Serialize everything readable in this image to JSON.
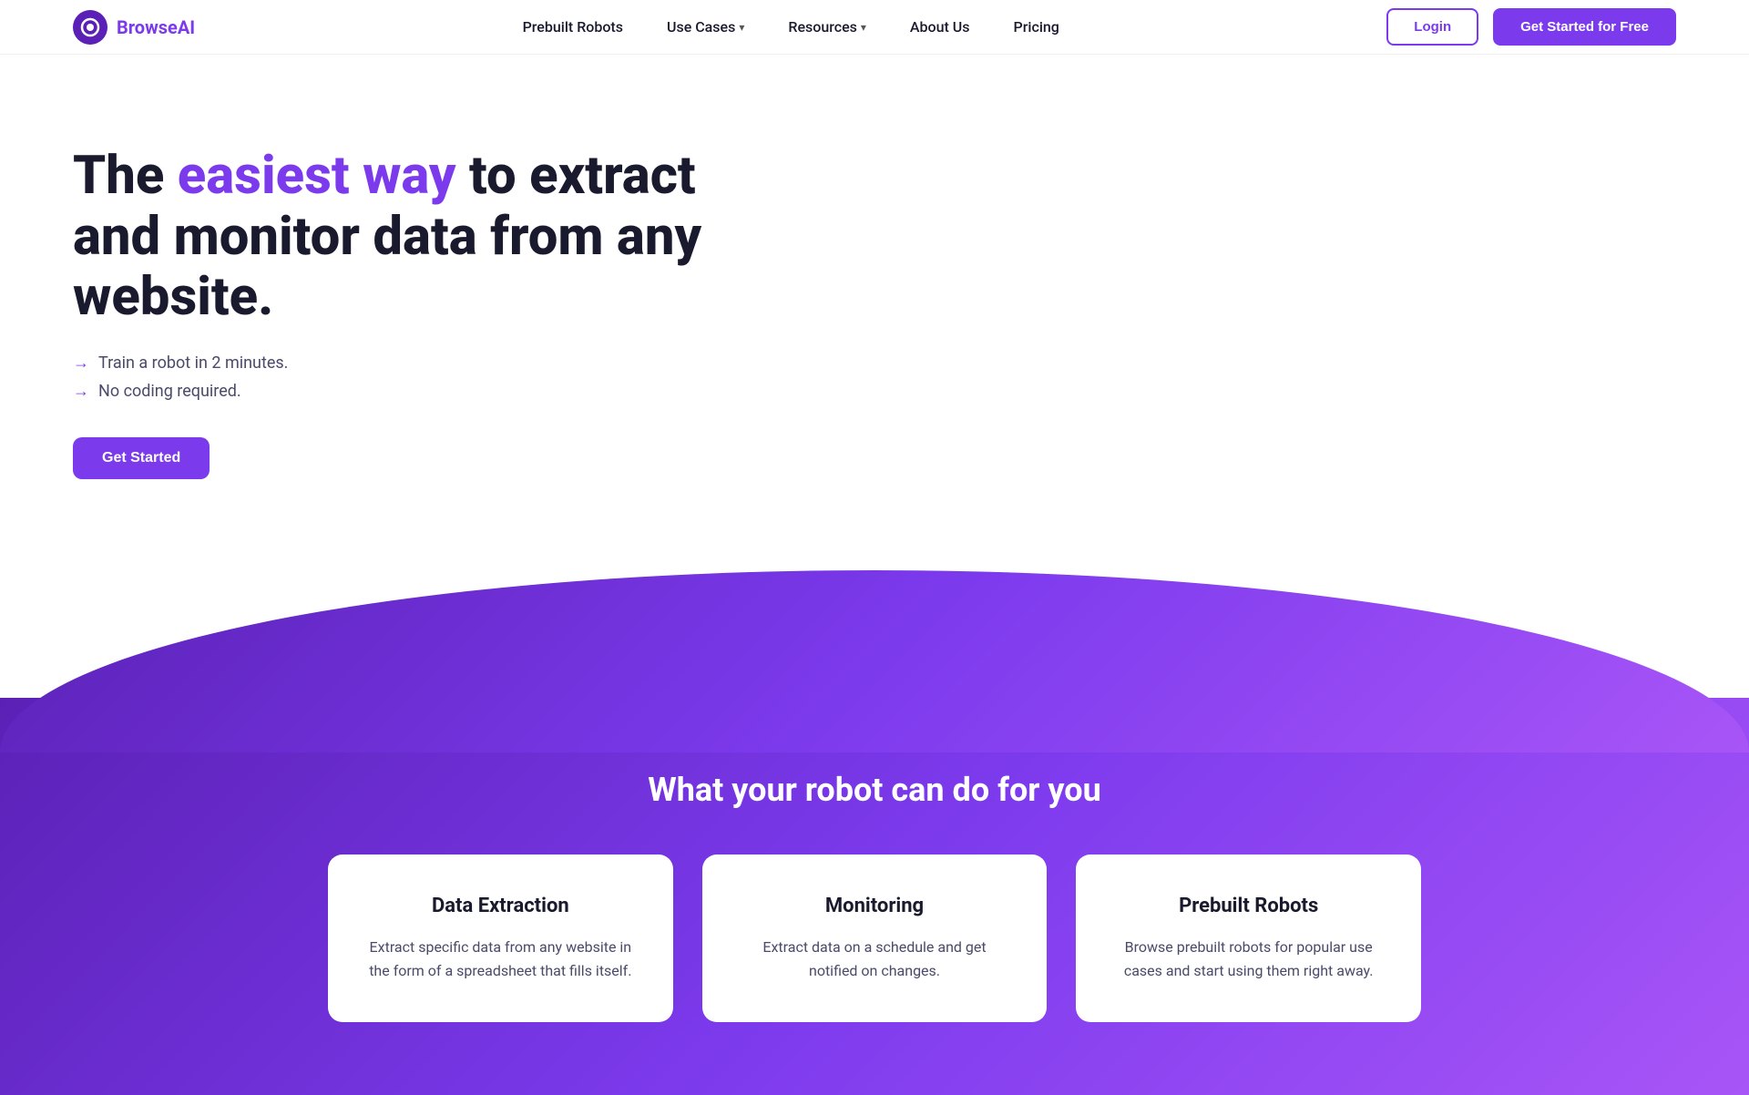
{
  "navbar": {
    "logo_text_browse": "Browse",
    "logo_text_ai": "AI",
    "nav_prebuilt": "Prebuilt Robots",
    "nav_use_cases": "Use Cases",
    "nav_resources": "Resources",
    "nav_about": "About Us",
    "nav_pricing": "Pricing",
    "btn_login": "Login",
    "btn_get_started": "Get Started for Free"
  },
  "hero": {
    "title_start": "The ",
    "title_highlight": "easiest way",
    "title_end": " to extract and monitor data from any website.",
    "bullet1": "Train a robot in 2 minutes.",
    "bullet2": "No coding required.",
    "cta_label": "Get Started"
  },
  "features_section": {
    "section_title": "What your robot can do for you",
    "cards": [
      {
        "title": "Data Extraction",
        "description": "Extract specific data from any website in the form of a spreadsheet that fills itself."
      },
      {
        "title": "Monitoring",
        "description": "Extract data on a schedule and get notified on changes."
      },
      {
        "title": "Prebuilt Robots",
        "description": "Browse prebuilt robots for popular use cases and start using them right away."
      }
    ]
  }
}
